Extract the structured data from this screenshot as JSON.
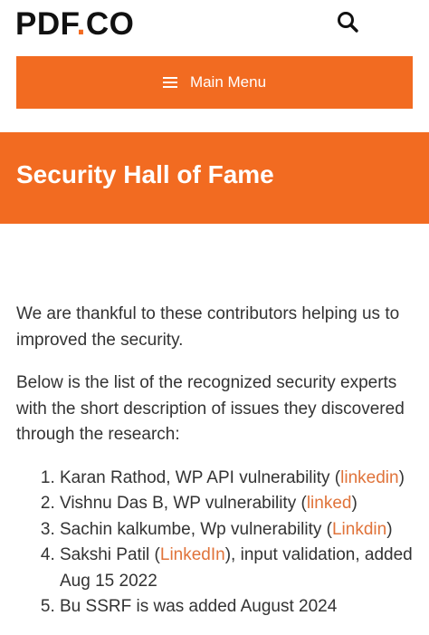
{
  "header": {
    "logo_main": "PDF",
    "logo_dot": ".",
    "logo_end": "CO",
    "search_icon": "search-icon"
  },
  "menu": {
    "label": "Main Menu",
    "icon": "hamburger-icon"
  },
  "hero": {
    "title": "Security Hall of Fame"
  },
  "intro": [
    "We are thankful to these contributors helping us to improved the security.",
    "Below is the list of the recognized security experts with the short description of issues they discovered through the research:"
  ],
  "contributors": [
    {
      "before": "Karan Rathod, WP API vulnerability (",
      "link": "linkedin",
      "after": ")"
    },
    {
      "before": "Vishnu Das B, WP vulnerability (",
      "link": "linked",
      "after": ")"
    },
    {
      "before": "Sachin kalkumbe, Wp vulnerability (",
      "link": "Linkdin",
      "after": ")"
    },
    {
      "before": "Sakshi Patil (",
      "link": "LinkedIn",
      "after": "), input validation, added Aug 15 2022"
    },
    {
      "before": "Bu SSRF is was added August 2024",
      "link": "",
      "after": ""
    }
  ],
  "colors": {
    "accent": "#f26b21",
    "link": "#e0733a"
  }
}
